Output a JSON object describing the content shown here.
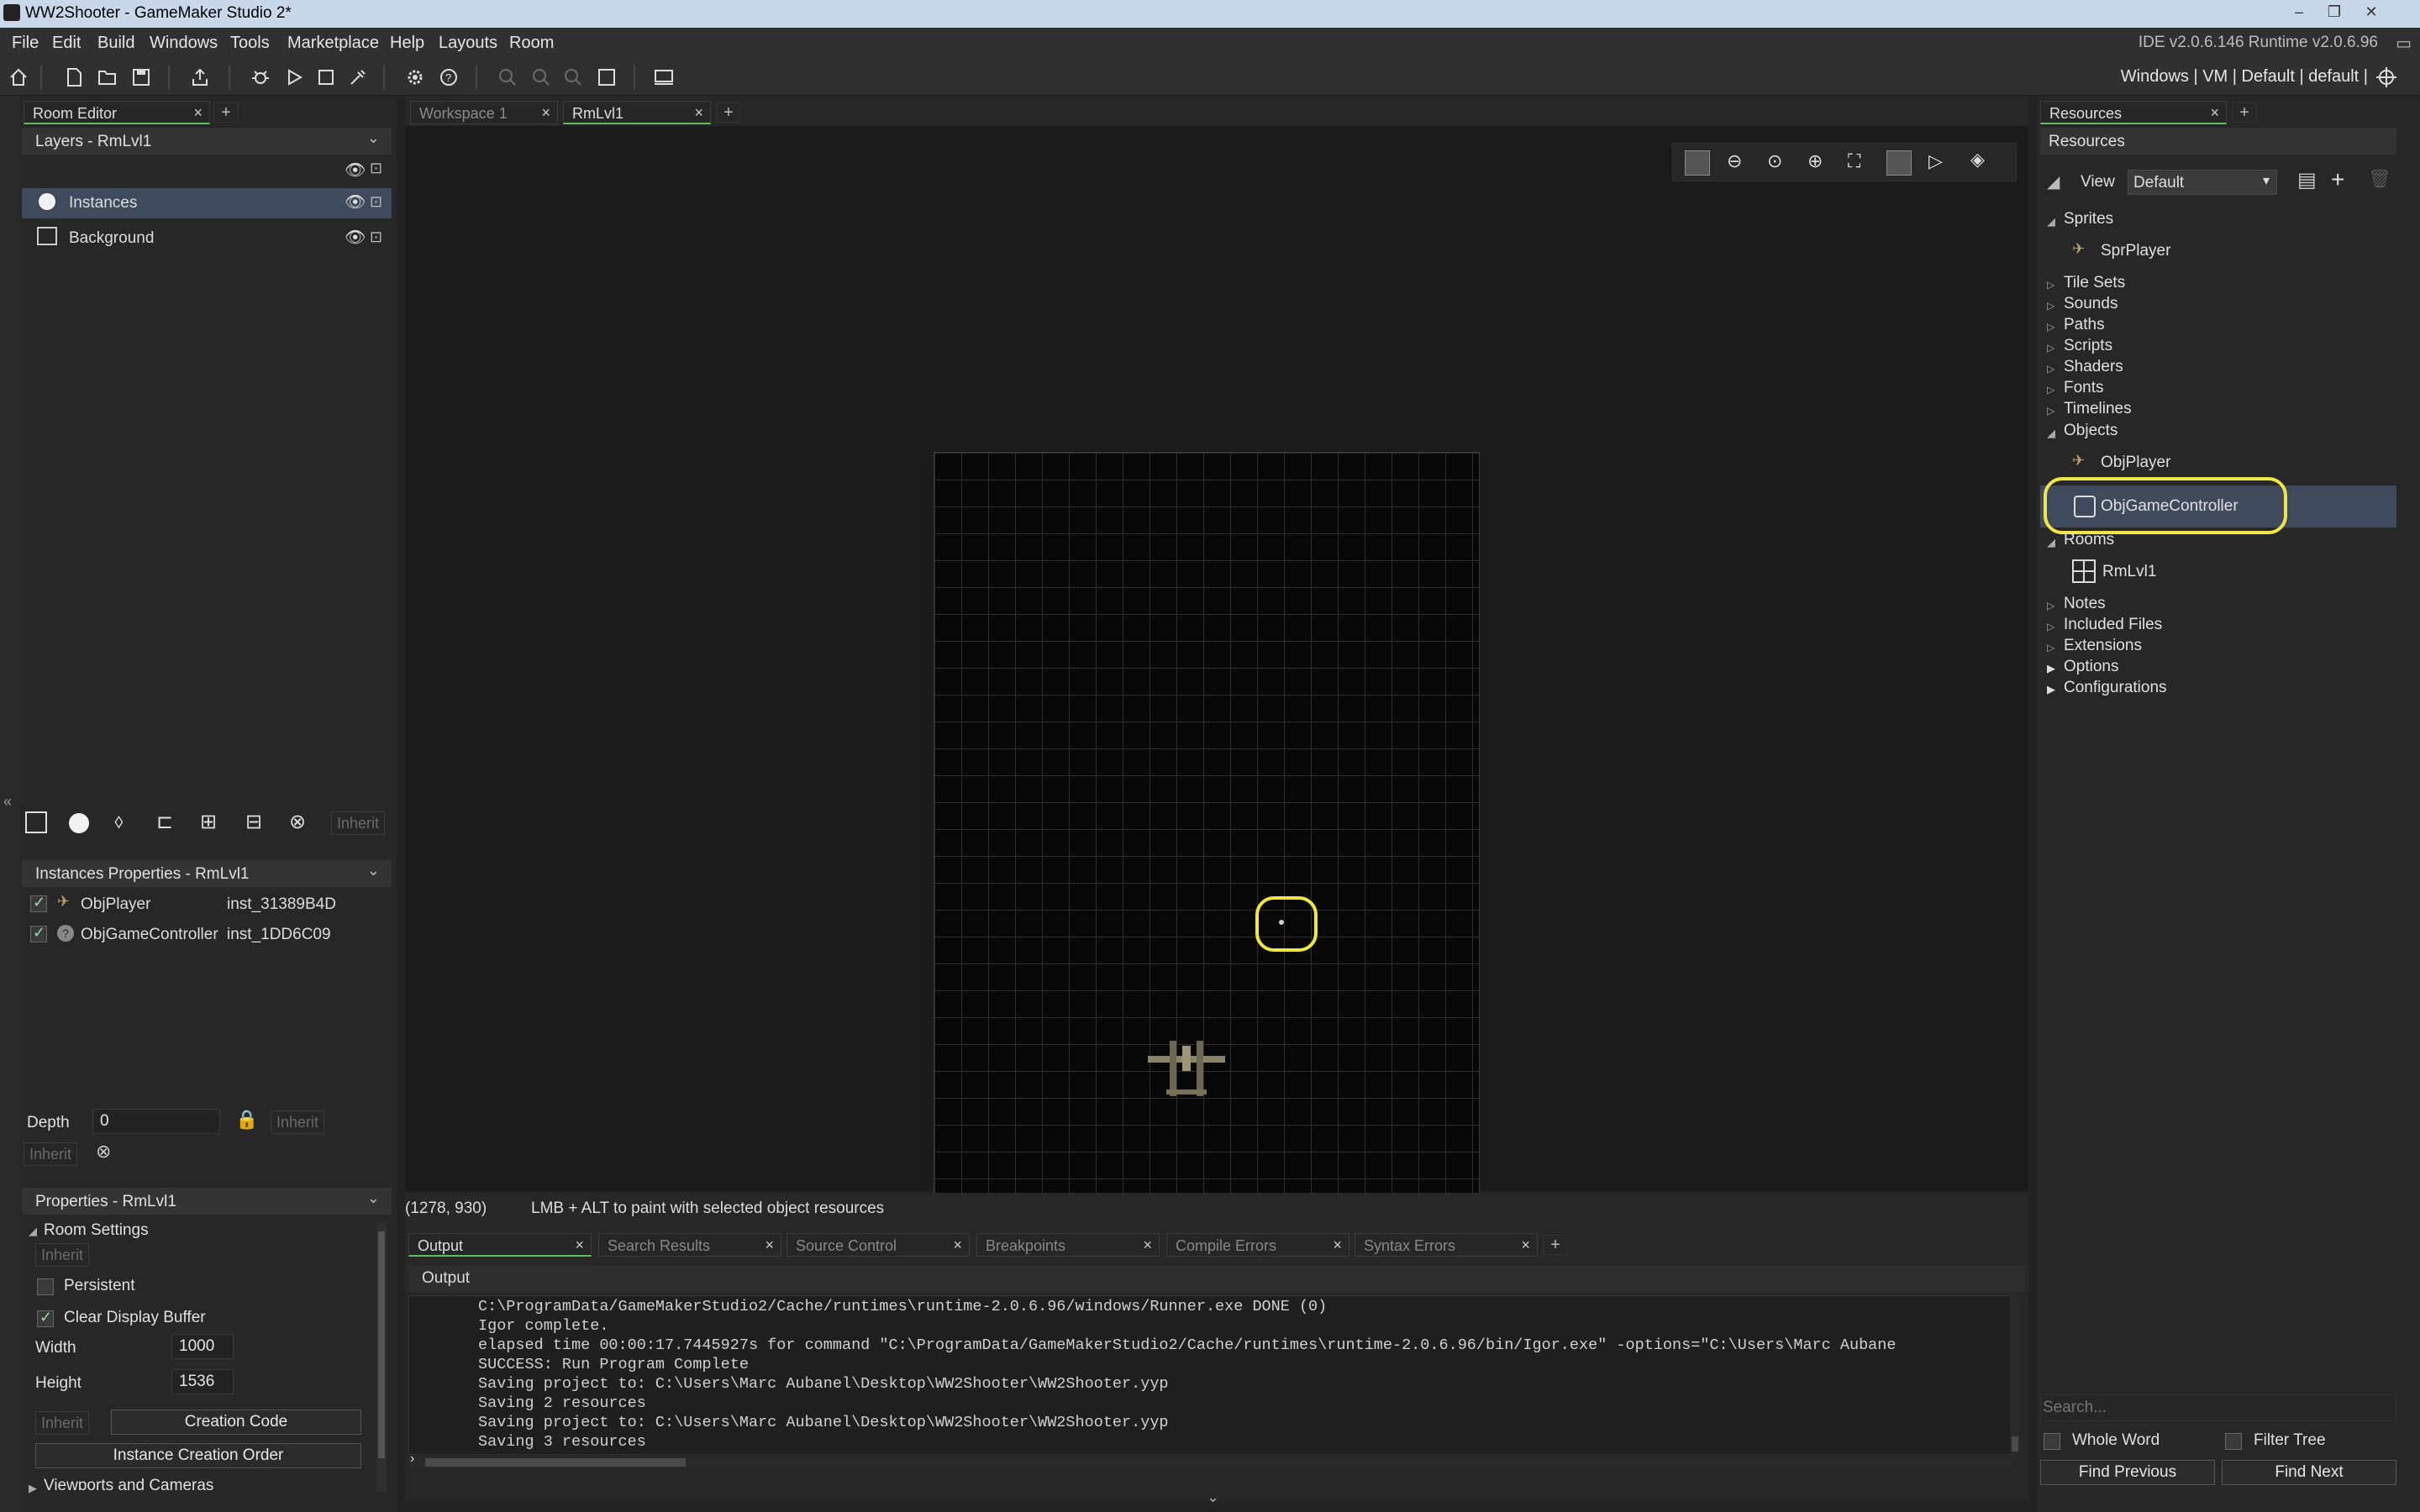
{
  "window": {
    "title": "WW2Shooter - GameMaker Studio 2*",
    "controls": [
      "–",
      "❐",
      "✕"
    ]
  },
  "menubar": {
    "items": [
      "File",
      "Edit",
      "Build",
      "Windows",
      "Tools",
      "Marketplace",
      "Help",
      "Layouts",
      "Room"
    ],
    "version": "IDE v2.0.6.146 Runtime v2.0.6.96"
  },
  "toolbar": {
    "target": "Windows | VM | Default | default |"
  },
  "left": {
    "tab": "Room Editor",
    "layers_header": "Layers - RmLvl1",
    "layers": [
      {
        "name": "Instances",
        "icon": "instance-layer-icon",
        "selected": true
      },
      {
        "name": "Background",
        "icon": "background-layer-icon",
        "selected": false
      }
    ],
    "layer_inherit": "Inherit",
    "instances_header": "Instances Properties - RmLvl1",
    "instances": [
      {
        "obj": "ObjPlayer",
        "id": "inst_31389B4D",
        "checked": true
      },
      {
        "obj": "ObjGameController",
        "id": "inst_1DD6C09",
        "checked": true
      }
    ],
    "depth_label": "Depth",
    "depth_value": "0",
    "inherit": "Inherit",
    "props_header": "Properties - RmLvl1",
    "room_settings": "Room Settings",
    "persistent": "Persistent",
    "clear_display": "Clear Display Buffer",
    "width_label": "Width",
    "width_value": "1000",
    "height_label": "Height",
    "height_value": "1536",
    "creation_code": "Creation Code",
    "instance_order": "Instance Creation Order",
    "viewports": "Viewports and Cameras"
  },
  "center": {
    "tabs": [
      {
        "label": "Workspace 1",
        "active": false
      },
      {
        "label": "RmLvl1",
        "active": true
      }
    ],
    "status_coords": "(1278, 930)",
    "status_hint": "LMB + ALT to paint with selected object resources"
  },
  "output": {
    "tabs": [
      "Output",
      "Search Results",
      "Source Control",
      "Breakpoints",
      "Compile Errors",
      "Syntax Errors"
    ],
    "header": "Output",
    "lines": [
      "C:\\ProgramData/GameMakerStudio2/Cache/runtimes\\runtime-2.0.6.96/windows/Runner.exe DONE (0)",
      "Igor complete.",
      "elapsed time 00:00:17.7445927s for command \"C:\\ProgramData/GameMakerStudio2/Cache/runtimes\\runtime-2.0.6.96/bin/Igor.exe\" -options=\"C:\\Users\\Marc Aubane",
      "SUCCESS: Run Program Complete",
      "Saving project to: C:\\Users\\Marc Aubanel\\Desktop\\WW2Shooter\\WW2Shooter.yyp",
      "Saving 2 resources",
      "Saving project to: C:\\Users\\Marc Aubanel\\Desktop\\WW2Shooter\\WW2Shooter.yyp",
      "Saving 3 resources"
    ]
  },
  "resources": {
    "tab": "Resources",
    "header": "Resources",
    "view_label": "View",
    "view_value": "Default",
    "sprites": "Sprites",
    "spr_player": "SprPlayer",
    "cats_a": [
      "Tile Sets",
      "Sounds",
      "Paths",
      "Scripts",
      "Shaders",
      "Fonts",
      "Timelines"
    ],
    "objects": "Objects",
    "obj_player": "ObjPlayer",
    "obj_controller": "ObjGameController",
    "rooms": "Rooms",
    "room1": "RmLvl1",
    "cats_b": [
      "Notes",
      "Included Files",
      "Extensions",
      "Options",
      "Configurations"
    ],
    "search_placeholder": "Search...",
    "whole_word": "Whole Word",
    "filter_tree": "Filter Tree",
    "find_prev": "Find Previous",
    "find_next": "Find Next"
  },
  "colors": {
    "accent_green": "#5ac05a",
    "highlight": "#f0e646",
    "selection": "#3f4b5c"
  }
}
